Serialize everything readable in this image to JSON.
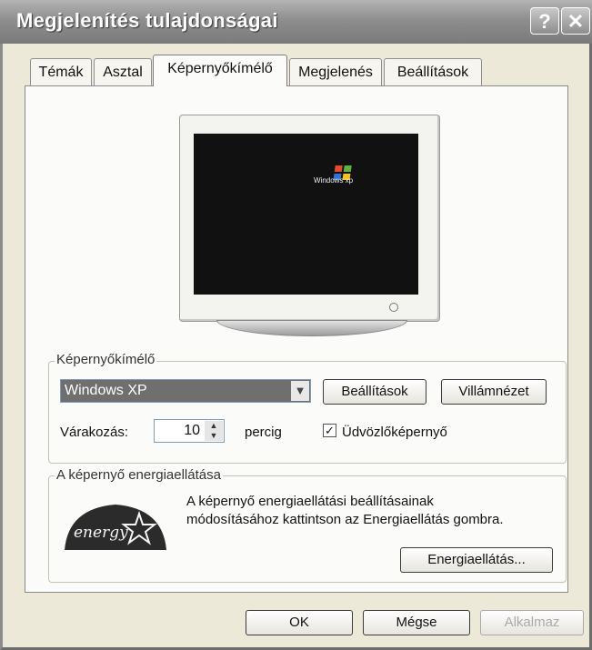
{
  "window": {
    "title": "Megjelenítés tulajdonságai",
    "help_button": "?",
    "close_button": "✕"
  },
  "tabs": [
    {
      "label": "Témák",
      "active": false
    },
    {
      "label": "Asztal",
      "active": false
    },
    {
      "label": "Képernyőkímélő",
      "active": true
    },
    {
      "label": "Megjelenés",
      "active": false
    },
    {
      "label": "Beállítások",
      "active": false
    }
  ],
  "preview": {
    "logo_text": "Windows xp"
  },
  "screensaver": {
    "group_label": "Képernyőkímélő",
    "selected": "Windows XP",
    "settings_button": "Beállítások",
    "preview_button": "Villámnézet",
    "wait_label": "Várakozás:",
    "wait_value": "10",
    "wait_unit": "percig",
    "welcome_checkbox_label": "Üdvözlőképernyő",
    "welcome_checked": true
  },
  "energy": {
    "group_label": "A képernyő energiaellátása",
    "logo_text": "energy",
    "description_line1": "A képernyő energiaellátási beállításainak",
    "description_line2": "módosításához kattintson az Energiaellátás gombra.",
    "button": "Energiaellátás..."
  },
  "footer": {
    "ok": "OK",
    "cancel": "Mégse",
    "apply": "Alkalmaz"
  }
}
